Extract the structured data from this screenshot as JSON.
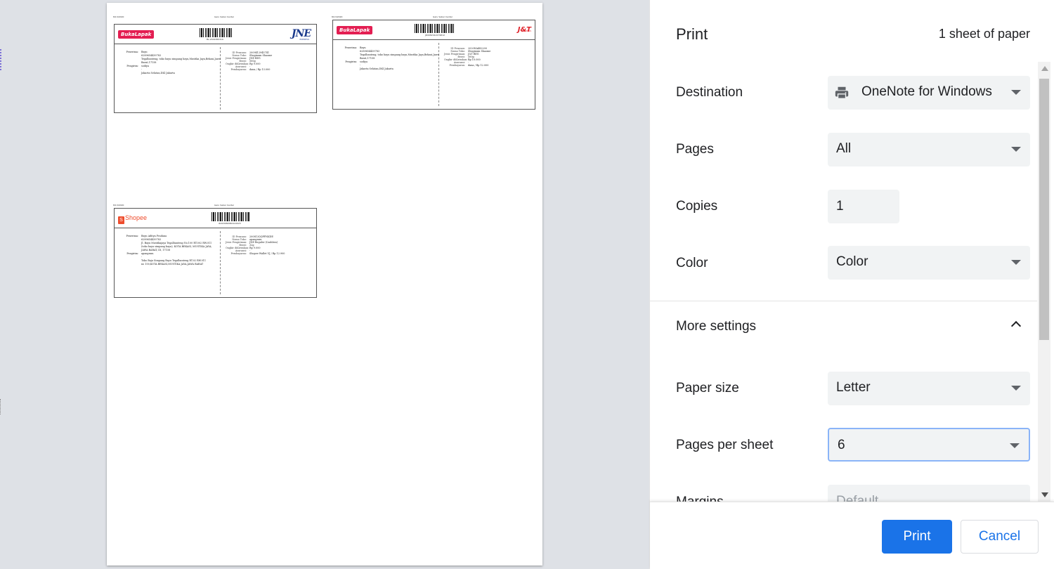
{
  "header": {
    "title": "Print",
    "sheet_count": "1 sheet of paper"
  },
  "settings": {
    "destination": {
      "label": "Destination",
      "value": "OneNote for Windows"
    },
    "pages": {
      "label": "Pages",
      "value": "All"
    },
    "copies": {
      "label": "Copies",
      "value": "1"
    },
    "color": {
      "label": "Color",
      "value": "Color"
    },
    "more_settings": {
      "label": "More settings"
    },
    "paper_size": {
      "label": "Paper size",
      "value": "Letter"
    },
    "pages_per_sheet": {
      "label": "Pages per sheet",
      "value": "6"
    },
    "margins": {
      "label": "Margins",
      "value": "Default"
    }
  },
  "buttons": {
    "print": "Print",
    "cancel": "Cancel"
  },
  "colors": {
    "accent": "#1a73e8",
    "focus_ring": "#8ab4f8",
    "select_bg": "#f1f3f4",
    "preview_bg": "#dee1e6"
  },
  "icons": {
    "destination": "printer-icon",
    "dropdown": "caret-down-icon",
    "more_settings": "chevron-up-icon"
  },
  "preview": {
    "labels": [
      {
        "courier": "JNE",
        "marketplace": "BukaLapak",
        "date": "8/13/2020",
        "header_center": "Garu Sabar Center",
        "tracking": "BL-2002380316",
        "fields": [
          [
            "ID Pesanan:",
            "2009412945741"
          ],
          [
            "Nama Toko:",
            "Sboginum Shaome"
          ],
          [
            "Jenis Pengiriman:",
            "JNE REG"
          ],
          [
            "Berat:",
            "500g"
          ],
          [
            "Ongkir diKirimkan:",
            "Rp 9.000"
          ],
          [
            "Asuransi:",
            "-"
          ],
          [
            "Pembayaran:",
            "dana / Rp 13.000"
          ]
        ],
        "penerima": [
          "Bayu",
          "6289654439783",
          "Tegalbanteng, toko bayu simpang bayu,Mustika Jaya,Bekasi,Jawa",
          "Barat,17158"
        ],
        "pengirim": [
          "sodiya",
          "-",
          "Jakarta Selatan,DKI Jakarta"
        ]
      },
      {
        "courier": "J&T",
        "marketplace": "BukaLapak",
        "date": "8/13/2020",
        "header_center": "Garu Sabar Center",
        "tracking": "JD0082412279812",
        "fields": [
          [
            "ID Pesanan:",
            "2020NA482200"
          ],
          [
            "Nama Toko:",
            "Sboginum Shaome"
          ],
          [
            "Jenis Pengiriman:",
            "J&T REG"
          ],
          [
            "Berat:",
            "500g"
          ],
          [
            "Ongkir diKirimkan:",
            "Rp 10.000"
          ],
          [
            "Asuransi:",
            "-"
          ],
          [
            "Pembayaran:",
            "dana / Rp 12.000"
          ]
        ],
        "penerima": [
          "Bayu",
          "6289654439783",
          "Tegalbanteng, toko bayu simpang bayu,Mustika Jaya,Bekasi,Jawa",
          "Barat,17158"
        ],
        "pengirim": [
          "sodiya",
          "-",
          "Jakarta Selatan,DKI Jakarta"
        ]
      },
      {
        "courier": "Shopee",
        "marketplace": "Shopee",
        "date": "8/13/2020",
        "header_center": "Garu Sabar Center",
        "tracking": "ID203982060122023",
        "fields": [
          [
            "ID Pesanan:",
            "200813QQPFNKDE"
          ],
          [
            "Nama Toko:",
            "apangram"
          ],
          [
            "Jenis Pengiriman:",
            "JNE Reguler (Cashless)"
          ],
          [
            "Berat:",
            "32g"
          ],
          [
            "Ongkir diKirimkan:",
            "Rp 9.000"
          ],
          [
            "Asuransi:",
            "-"
          ],
          [
            "Pembayaran:",
            "Shopee Wallet VJ / Rp 12.900"
          ]
        ],
        "penerima": [
          "Bayu Aditya Pradana",
          "6289654439783",
          "Jl. Bayu Mustikajaya Tegalbanteng No.100 RT.002 RW.011",
          "(toko bayu simpang bayu), KOTA BEKASI, MUSTIKA JAYA,",
          "JAWA BARAT, ID, 17158"
        ],
        "pengirim": [
          "apangram",
          "-",
          "Toko Baju Simpang Bayu Tegalbanteng RT.02 RW.011",
          "no 100,KOTA BEKASI,MUSTIKA JAYA,JAWA BARAT"
        ]
      }
    ]
  }
}
